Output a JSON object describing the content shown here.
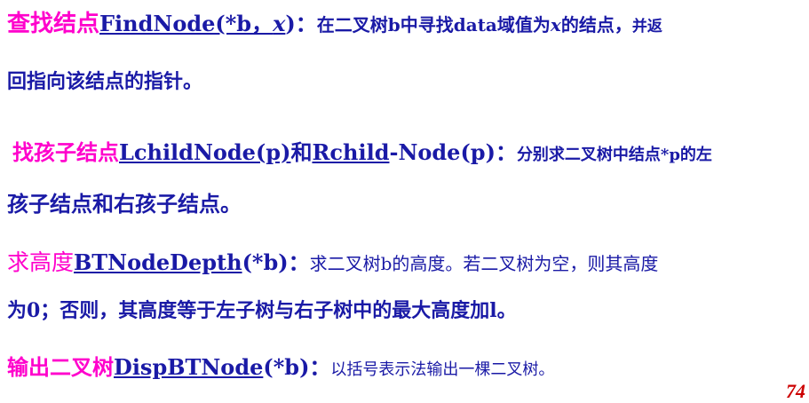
{
  "items": [
    {
      "title": "查找结点",
      "func": "FindNode(*b，",
      "func_param": "x",
      "func_end": ")：",
      "desc_a": "在二叉树b中寻找data域值为",
      "desc_x": "x",
      "desc_b": "的结点，",
      "desc_c": "并返",
      "desc_line2": "回指向该结点的指针。"
    },
    {
      "title": "找孩子结点",
      "func1": "LchildNode(p)",
      "conj": "和",
      "func2": "Rchild",
      "func2_rest": "-Node(p)",
      "colon": "：",
      "desc": "分别求二叉树中结点*p的左",
      "desc_line2": "孩子结点和右孩子结点。"
    },
    {
      "title": "求高度",
      "func": "BTNodeDepth",
      "func_rest": "(*b)：",
      "desc": "求二叉树b的高度。若二叉树为空，则其高度",
      "desc_line2": "为0；否则，其高度等于左子树与右子树中的最大高度加l。"
    },
    {
      "title": "输出二叉树",
      "func": "DispBTNode",
      "func_rest": "(*b)：",
      "desc": "以括号表示法输出一棵二叉树。"
    }
  ],
  "page_number": "74",
  "colors": {
    "title": "#ff00cc",
    "text": "#1a1aa6",
    "page_number": "#cc0000"
  }
}
